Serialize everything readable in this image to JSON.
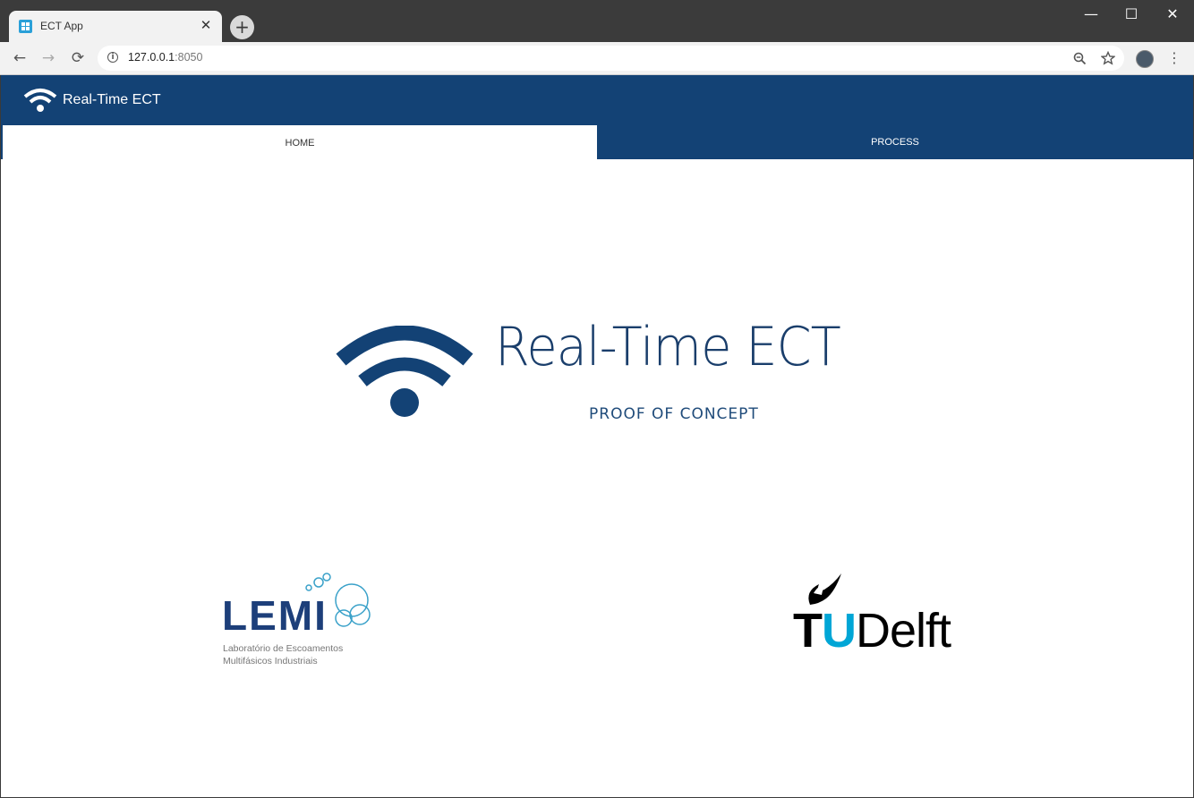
{
  "browser": {
    "tab_title": "ECT App",
    "tab_close": "✕",
    "new_tab": "+",
    "url_host": "127.0.0.1",
    "url_port": ":8050",
    "window_controls": {
      "minimize": "—",
      "maximize": "☐",
      "close": "✕"
    }
  },
  "app": {
    "header_title": "Real-Time ECT",
    "tabs": [
      {
        "label": "HOME",
        "active": true
      },
      {
        "label": "PROCESS",
        "active": false
      }
    ],
    "hero": {
      "title": "Real-Time ECT",
      "subtitle": "PROOF OF CONCEPT"
    },
    "logos": {
      "lemi_text": "LEMI",
      "lemi_sub_line1": "Laboratório de Escoamentos",
      "lemi_sub_line2": "Multifásicos Industriais",
      "tud_t": "T",
      "tud_u": "U",
      "tud_delft": "Delft"
    }
  },
  "colors": {
    "brand_navy": "#134275",
    "hero_text": "#1a3e6b",
    "tud_blue": "#00a6d6"
  },
  "icons": [
    "wifi-icon",
    "info-icon",
    "zoom-icon",
    "star-icon",
    "back-icon",
    "forward-icon",
    "reload-icon",
    "menu-icon"
  ]
}
